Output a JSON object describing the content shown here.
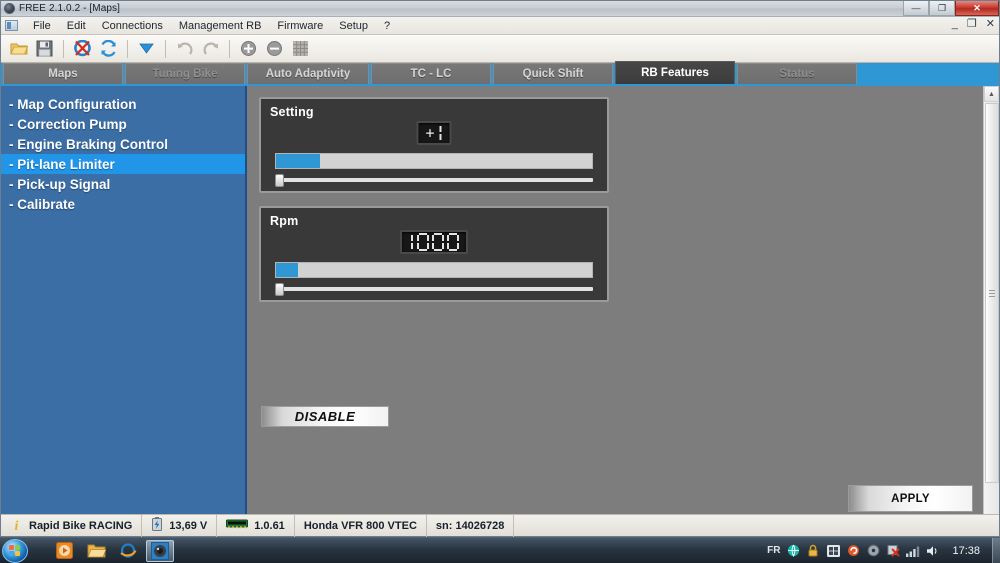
{
  "window": {
    "title": "FREE  2.1.0.2 - [Maps]",
    "icon": "app-logo-icon",
    "controls": {
      "minimize": "—",
      "maximize": "❐",
      "close": "✕"
    },
    "mdi_controls": {
      "minimize": "_",
      "restore": "❐",
      "close": "✕"
    }
  },
  "menubar": {
    "items": [
      {
        "label": "File"
      },
      {
        "label": "Edit"
      },
      {
        "label": "Connections"
      },
      {
        "label": "Management RB"
      },
      {
        "label": "Firmware"
      },
      {
        "label": "Setup"
      },
      {
        "label": "?"
      }
    ]
  },
  "toolbar": {
    "buttons": [
      {
        "name": "open-folder-icon",
        "title": "Open"
      },
      {
        "name": "save-icon",
        "title": "Save"
      },
      {
        "name": "disconnect-icon",
        "title": "Disconnect"
      },
      {
        "name": "connect-sync-icon",
        "title": "Connect"
      },
      {
        "name": "download-icon",
        "title": "Download"
      },
      {
        "name": "undo-icon",
        "title": "Undo"
      },
      {
        "name": "redo-icon",
        "title": "Redo"
      },
      {
        "name": "zoom-in-icon",
        "title": "Zoom in"
      },
      {
        "name": "zoom-out-icon",
        "title": "Zoom out"
      },
      {
        "name": "grid-icon",
        "title": "Grid"
      }
    ]
  },
  "tabs": [
    {
      "label": "Maps",
      "state": "normal"
    },
    {
      "label": "Tuning Bike",
      "state": "dim"
    },
    {
      "label": "Auto Adaptivity",
      "state": "normal"
    },
    {
      "label": "TC - LC",
      "state": "normal"
    },
    {
      "label": "Quick Shift",
      "state": "normal"
    },
    {
      "label": "RB Features",
      "state": "active"
    },
    {
      "label": "Status",
      "state": "dim"
    }
  ],
  "sidebar": {
    "items": [
      {
        "label": "- Map Configuration",
        "selected": false
      },
      {
        "label": "- Correction Pump",
        "selected": false
      },
      {
        "label": "- Engine Braking Control",
        "selected": false
      },
      {
        "label": "- Pit-lane Limiter",
        "selected": true
      },
      {
        "label": "- Pick-up Signal",
        "selected": false
      },
      {
        "label": "- Calibrate",
        "selected": false
      }
    ]
  },
  "panels": {
    "setting": {
      "title": "Setting",
      "display_value": "+1",
      "meter_percent": 14,
      "slider_percent": 0
    },
    "rpm": {
      "title": "Rpm",
      "display_value": "1000",
      "meter_percent": 7,
      "slider_percent": 0
    }
  },
  "buttons": {
    "disable": "DISABLE",
    "apply": "APPLY"
  },
  "scrollbar": {
    "up_arrow": "▲",
    "down_arrow": "▼"
  },
  "statusbar": {
    "device_name": "Rapid Bike RACING",
    "voltage": "13,69 V",
    "firmware": "1.0.61",
    "vehicle": "Honda VFR 800 VTEC",
    "serial": "sn: 14026728",
    "icons": {
      "info": "info-icon",
      "battery": "battery-icon",
      "module": "memory-module-icon"
    }
  },
  "taskbar": {
    "start": "start-orb-icon",
    "apps": [
      {
        "name": "media-player-icon",
        "active": false
      },
      {
        "name": "file-explorer-icon",
        "active": false
      },
      {
        "name": "internet-explorer-icon",
        "active": false
      },
      {
        "name": "rapid-bike-app-icon",
        "active": true
      }
    ],
    "tray": {
      "language": "FR",
      "icons": [
        "network-globe-icon",
        "security-lock-icon",
        "windows-flag-icon",
        "update-icon",
        "disc-icon",
        "antivirus-alert-icon",
        "signal-bars-icon",
        "volume-icon"
      ]
    },
    "clock": "17:38"
  },
  "colors": {
    "accent_blue": "#2f97d4",
    "sidebar_blue": "#3a6ea5",
    "selected_blue": "#2196e8",
    "panel_dark": "#393939",
    "content_gray": "#7d7d7d"
  }
}
